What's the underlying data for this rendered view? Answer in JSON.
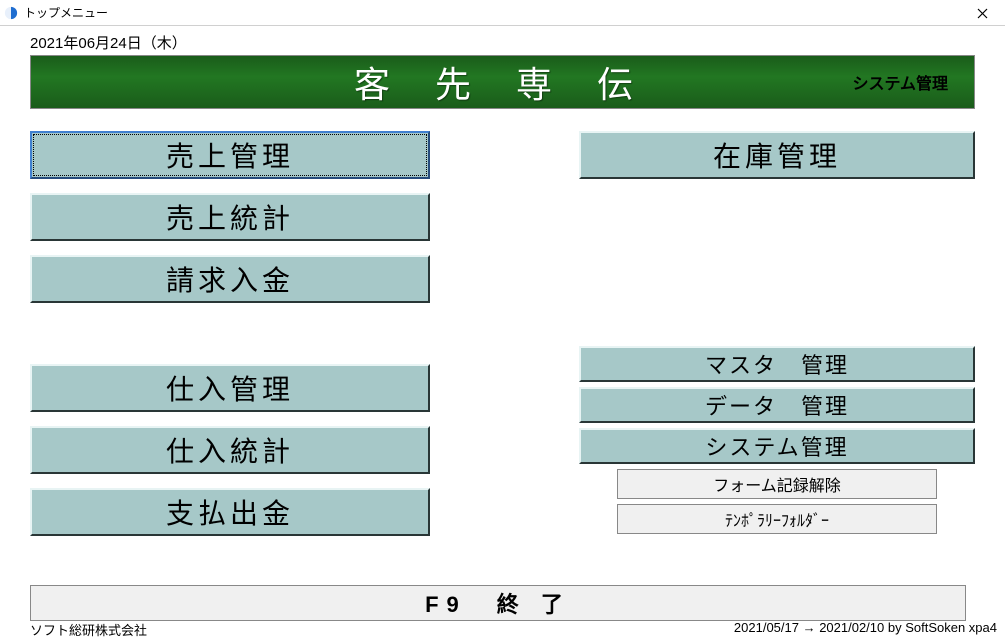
{
  "window": {
    "title": "トップメニュー"
  },
  "date_label": "2021年06月24日（木）",
  "banner": {
    "title": "客 先 専 伝",
    "right_label": "システム管理"
  },
  "left_group1": {
    "btn1": "売上管理",
    "btn2": "売上統計",
    "btn3": "請求入金"
  },
  "left_group2": {
    "btn1": "仕入管理",
    "btn2": "仕入統計",
    "btn3": "支払出金"
  },
  "right_group1": {
    "btn1": "在庫管理"
  },
  "right_group2": {
    "btn1": "マスタ　管理",
    "btn2": "データ　管理",
    "btn3": "システム管理",
    "btn4": "フォーム記録解除",
    "btn5": "ﾃﾝﾎﾟﾗﾘｰﾌｫﾙﾀﾞｰ"
  },
  "exit_label": "F9　終 了",
  "footer": {
    "left": "ソフト総研株式会社",
    "right": "2021/05/17 → 2021/02/10 by SoftSoken xpa4"
  }
}
